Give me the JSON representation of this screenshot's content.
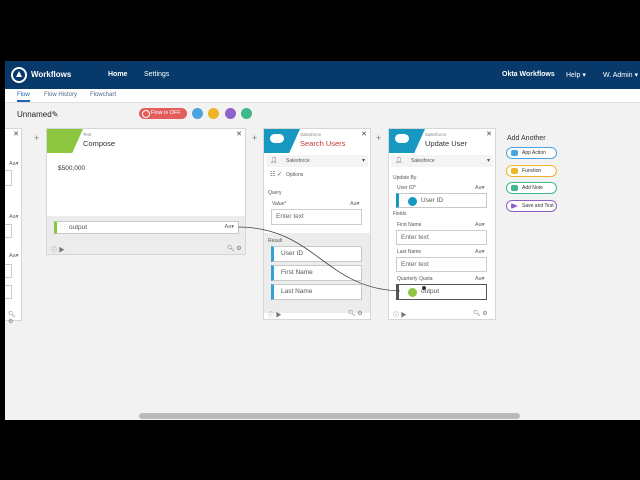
{
  "header": {
    "app_title": "Workflows",
    "nav_home": "Home",
    "nav_settings": "Settings",
    "nav_okta": "Okta Workflows",
    "nav_help": "Help ▾",
    "nav_user": "W. Admin ▾"
  },
  "subnav": {
    "flow": "Flow",
    "history": "Flow History",
    "flowchart": "Flowchart"
  },
  "toolbar": {
    "flow_name": "Unnamed",
    "flow_status": "Flow is OFF"
  },
  "compose": {
    "sub": "Text",
    "title": "Compose",
    "value": "$500,000",
    "output_label": "output",
    "type_label": "Aa▾"
  },
  "search": {
    "sub": "Salesforce",
    "title": "Search Users",
    "connection": "Salesforce",
    "options": "Options",
    "query_label": "Query",
    "value_label": "Value",
    "required_mark": "*",
    "value_placeholder": "Enter text",
    "type_label": "Aa▾",
    "result_label": "Result",
    "result_fields": [
      "User ID",
      "First Name",
      "Last Name"
    ]
  },
  "update": {
    "sub": "Salesforce",
    "title": "Update User",
    "connection": "Salesforce",
    "update_by": "Update By",
    "user_id_label": "User ID*",
    "user_id_pill": "User ID",
    "fields_label": "Fields",
    "first_name_label": "First Name",
    "first_name_placeholder": "Enter text",
    "last_name_label": "Last Name",
    "last_name_placeholder": "Enter text",
    "quota_label": "Quarterly Quota",
    "quota_pill": "output",
    "type_label": "Aa▾"
  },
  "add_another": {
    "title": "Add Another",
    "buttons": [
      "App Action",
      "Function",
      "Add Note",
      "Save and Test"
    ]
  },
  "colors": {
    "topbar": "#07396b",
    "compose_tag": "#8cc63f",
    "salesforce": "#1798c1",
    "flow_off": "#e35d5d"
  }
}
